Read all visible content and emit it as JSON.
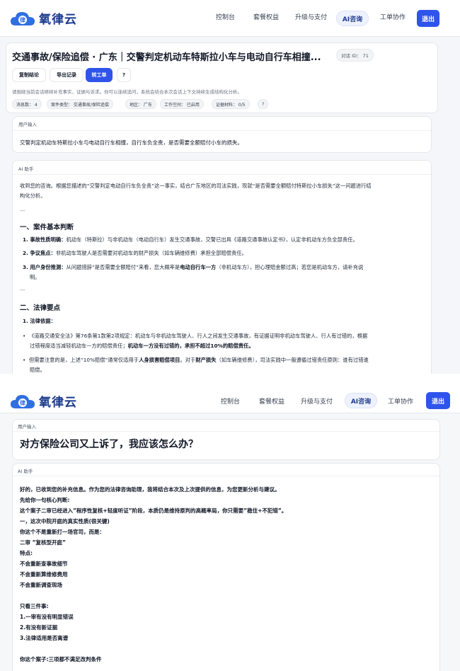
{
  "nav": {
    "logo_text": "氧律云",
    "links": [
      "控制台",
      "套餐权益",
      "升级与支付",
      "AI咨询",
      "工单协作"
    ],
    "logout": "退出",
    "brand_color": "#2f54eb"
  },
  "session": {
    "title": "交通事故/保险追偿 · 广东｜交警判定机动车特斯拉小车与电动自行车相撞...",
    "session_id": "对话 ID： 71",
    "buttons": [
      "复制结论",
      "导出记录",
      "转工单",
      "?"
    ],
    "hint": "请围绕当前会话继续补充事实、证据与诉求。你可以连续追问，系统会结合本次会话上下文持续生成结构化分析。",
    "tags": [
      "消息数： 4",
      "案件类型： 交通事故/保险追偿",
      "地区： 广东",
      "工作空间： 已启用",
      "证据材料： 0/5",
      "?"
    ]
  },
  "msg1": {
    "role": "用户输入",
    "text": "交警判定机动车特斯拉小车与电动自行车相撞，自行车负全责，是否需要全额赔付小车的损失。"
  },
  "msg2": {
    "role": "AI 助手",
    "intro_1": "收到您的咨询。根据您描述的“交警判定电动自行车负全责”这一事实，结合广东地区的司法实践，现就“是否需要全额赔付特斯拉小车损失”这一问题进行结",
    "intro_2": "构化分析。",
    "sep": "---",
    "h1": "一、案件基本判断",
    "item1_label": "1. 事故性质明确：",
    "item1_text": "机动车（特斯拉）与非机动车（电动自行车）发生交通事故，交警已出具《道路交通事故认定书》，认定非机动车方负全部责任。",
    "item2_label": "2. 争议焦点：",
    "item2_text": "非机动车驾驶人是否需要对机动车的财产损失（如车辆维修费）承担全部赔偿责任。",
    "item3_label": "3. 用户身份推测：",
    "item3_text_a": "从问题措辞“是否需要全额赔付”来看，您大概率是",
    "item3_bold": "电动自行车一方",
    "item3_text_b": "（非机动车方），担心理赔金额过高；若您是机动车方，请补充说",
    "item3_text_c": "明。",
    "sep2": "---",
    "h2": "二、法律要点",
    "sub1": "1. 法律依据：",
    "b1_a": "《道路交通安全法》第76条第1款第2项规定：机动车与非机动车驾驶人、行人之间发生交通事故，有证据证明非机动车驾驶人、行人有过错的，根据",
    "b1_b": "过错程度适当减轻机动车一方的赔偿责任；",
    "b1_bold": "机动车一方没有过错的，承担不超过10%的赔偿责任。",
    "b2_a": "但需要注意的是，上述“10%赔偿”通常仅适用于",
    "b2_bold1": "人身损害赔偿项目",
    "b2_mid": "。对于",
    "b2_bold2": "财产损失",
    "b2_end": "（如车辆维修费），司法实践中一般遵循过错责任原则：谁有过错谁",
    "b2_c": "赔偿。"
  },
  "shot2": {
    "user_role": "用户输入",
    "question": "对方保险公司又上诉了，我应该怎么办？",
    "ai_role": "AI 助手",
    "lines": [
      "好的，已收到您的补充信息。作为您的法律咨询助理，我将结合本次及上次提供的信息，为您更新分析与建议。",
      "先给你一句核心判断:",
      "这个案子二审已经进入”程序性复核+轻度听证”阶段，本质仍是维持原判的高概率局，你只需要”稳住+不犯错”。",
      "一，这次中院开庭的真实性质(很关键)",
      "你这个不是重新打一场官司，而是：",
      "二审 ”复核型开庭”",
      "特点:",
      "不会重新查事故细节",
      "不会重新算维修费用",
      "不会重新调查现场",
      "",
      "只看三件事:",
      "1.一审有没有明显错误",
      "2.有没有新证据",
      "3.法律适用是否离谱",
      "",
      "你这个案子:三项都不满足改判条件"
    ]
  }
}
